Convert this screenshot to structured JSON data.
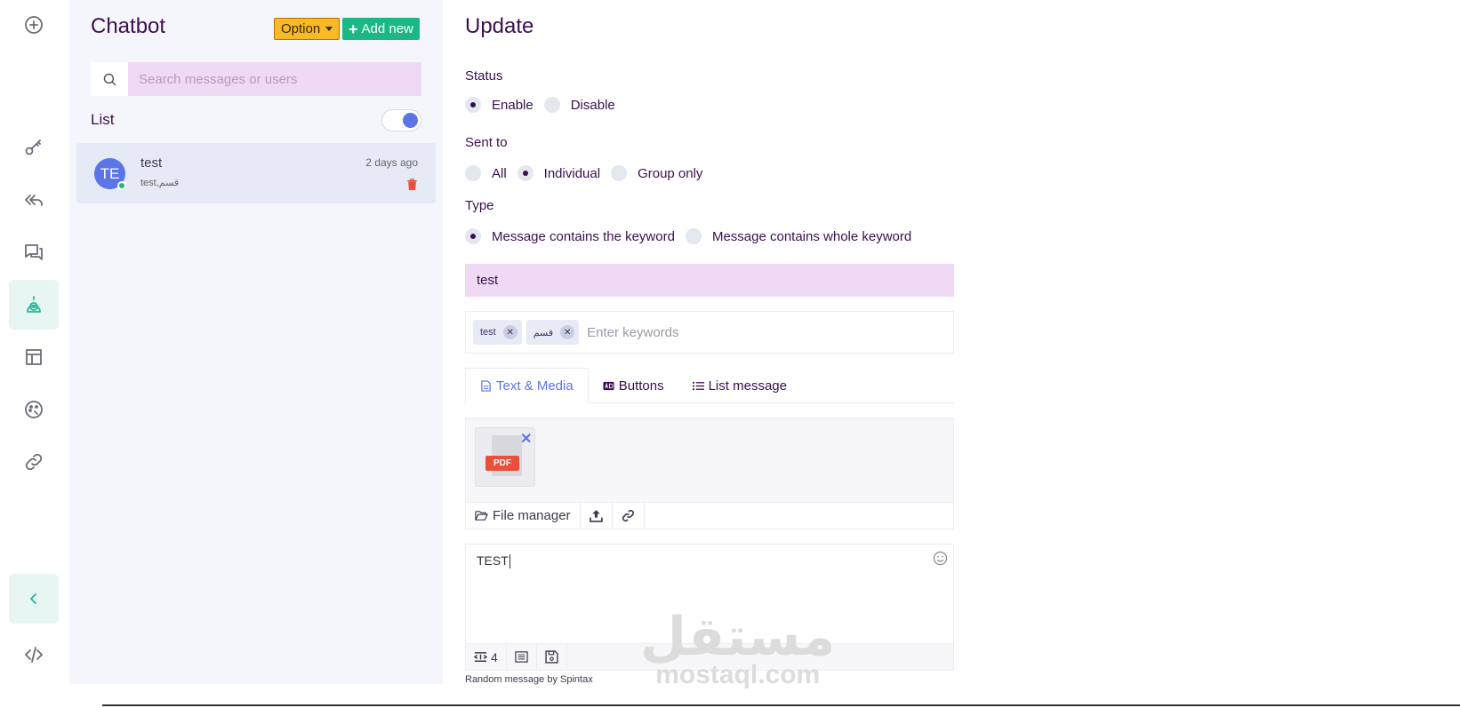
{
  "sidebar_icons": [
    "add-circle-icon",
    "key-icon",
    "reply-all-icon",
    "chat-icon",
    "robot-icon",
    "template-icon",
    "palette-icon",
    "link-icon",
    "collapse-icon",
    "code-icon"
  ],
  "chatbot_panel": {
    "title": "Chatbot",
    "option_label": "Option",
    "add_label": "Add new",
    "search_placeholder": "Search messages or users",
    "list_label": "List",
    "list_toggle_on": true,
    "items": [
      {
        "initials": "TE",
        "name": "test",
        "preview": "test,قسم",
        "time": "2 days ago"
      }
    ]
  },
  "form": {
    "title": "Update",
    "status": {
      "label": "Status",
      "options": [
        "Enable",
        "Disable"
      ],
      "selected": "Enable"
    },
    "sent_to": {
      "label": "Sent to",
      "options": [
        "All",
        "Individual",
        "Group only"
      ],
      "selected": "Individual"
    },
    "type": {
      "label": "Type",
      "options": [
        "Message contains the keyword",
        "Message contains whole keyword"
      ],
      "selected": "Message contains the keyword"
    },
    "keyword_value": "test",
    "tags": [
      "test",
      "قسم"
    ],
    "tags_placeholder": "Enter keywords",
    "tabs": [
      "Text & Media",
      "Buttons",
      "List message"
    ],
    "active_tab": "Text & Media",
    "attachment_type": "PDF",
    "file_manager_label": "File manager",
    "message_text": "TEST",
    "spintax_count": "4",
    "spintax_note": "Random message by Spintax"
  },
  "watermark": {
    "arabic": "مستقل",
    "latin": "mostaql.com"
  },
  "colors": {
    "accent_purple": "#3b0f4f",
    "accent_blue": "#5b74e8",
    "green": "#1bb784",
    "orange": "#f7b924",
    "input_bg": "#f0d9f5"
  }
}
